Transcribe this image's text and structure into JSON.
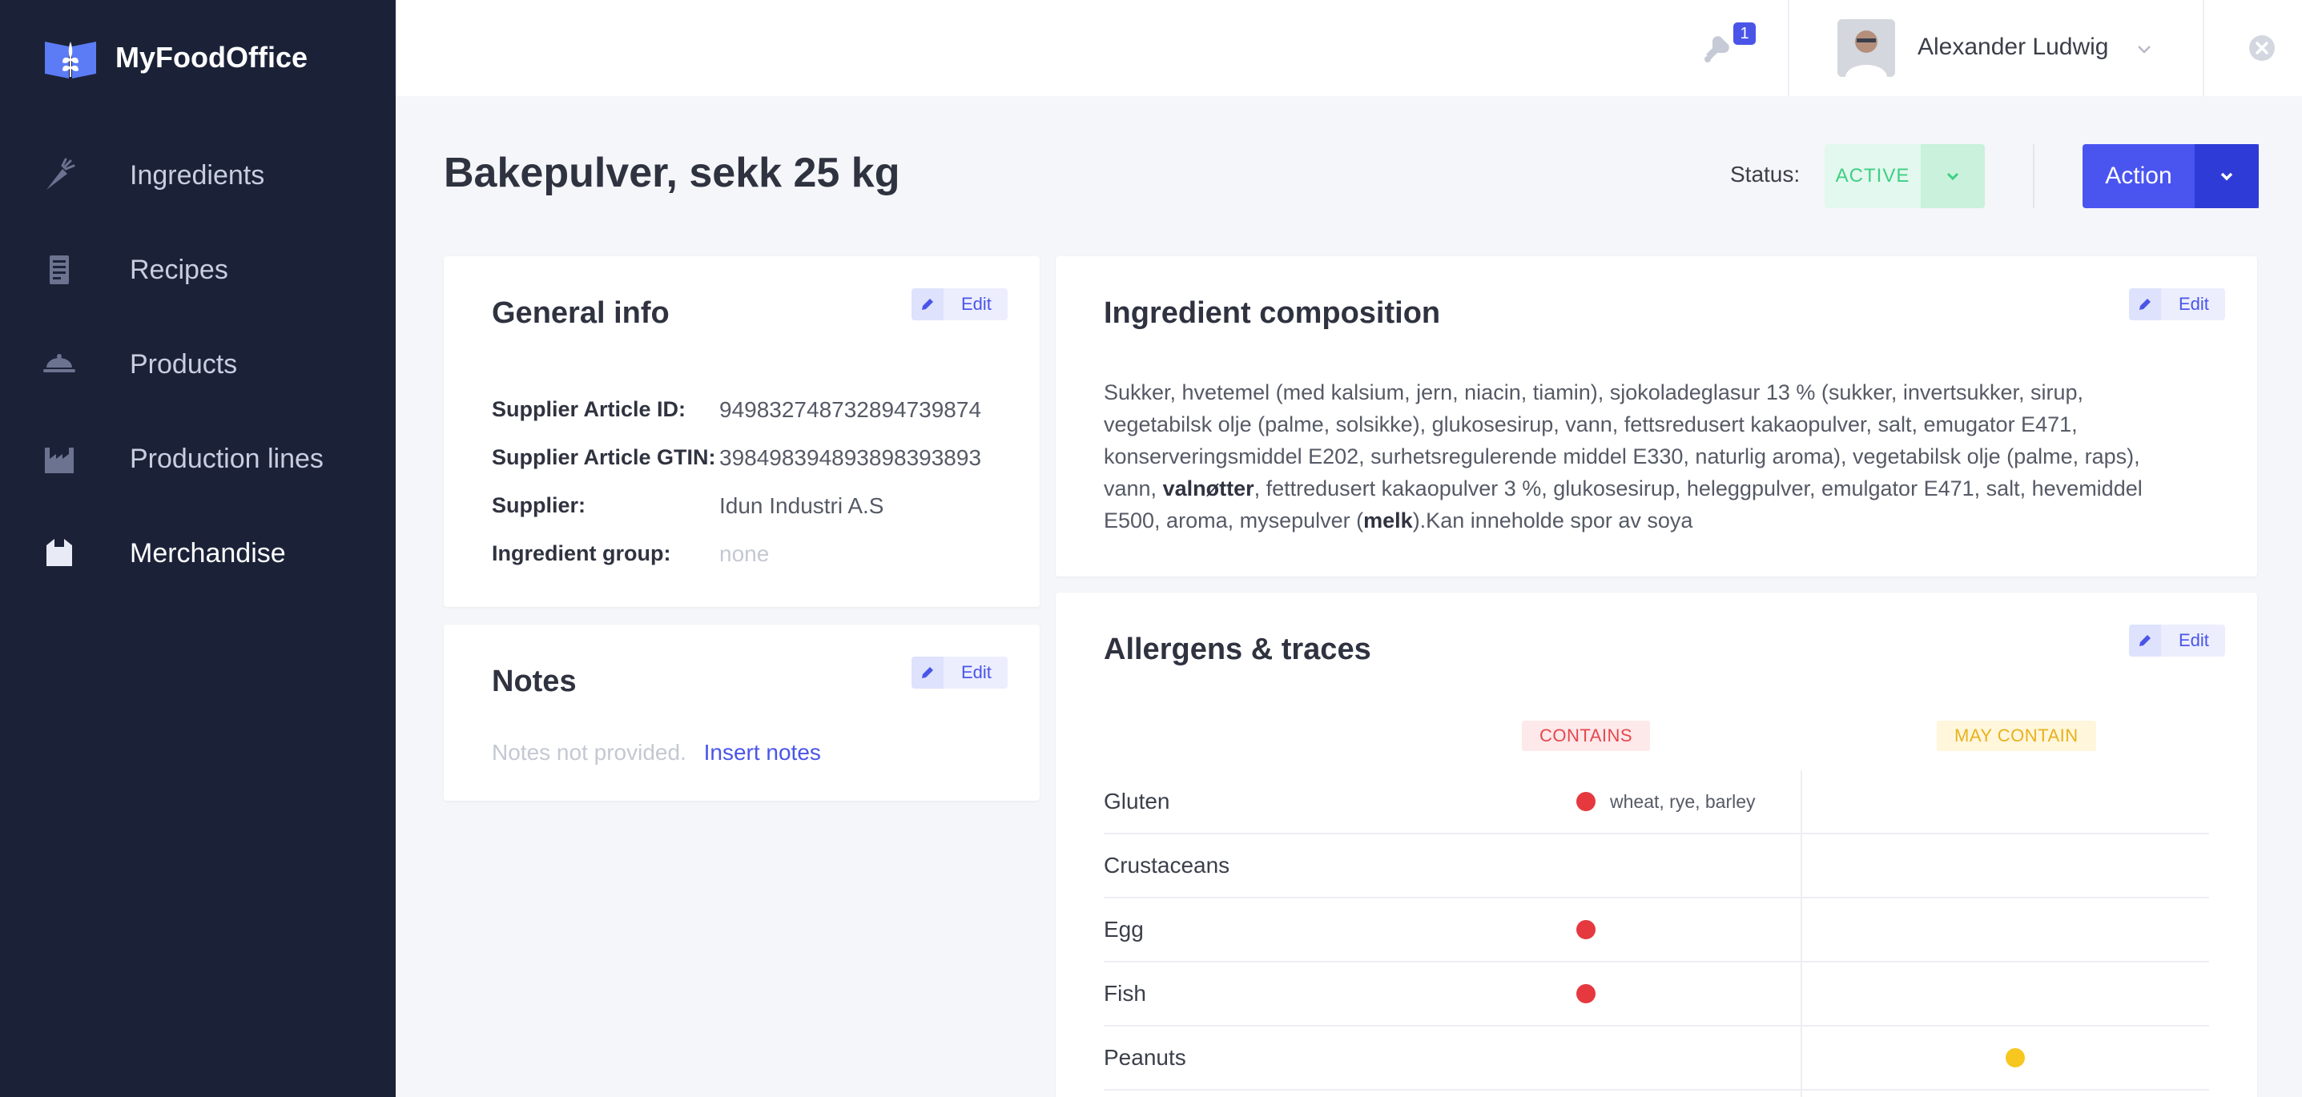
{
  "app": {
    "brand_name": "MyFoodOffice"
  },
  "sidebar": {
    "items": [
      {
        "label": "Ingredients",
        "icon": "carrot-icon"
      },
      {
        "label": "Recipes",
        "icon": "recipe-book-icon"
      },
      {
        "label": "Products",
        "icon": "dish-icon"
      },
      {
        "label": "Production lines",
        "icon": "factory-icon"
      },
      {
        "label": "Merchandise",
        "icon": "box-icon",
        "active": true
      }
    ]
  },
  "topbar": {
    "notification_count": "1",
    "user_name": "Alexander Ludwig"
  },
  "page": {
    "title": "Bakepulver, sekk 25 kg",
    "status_label": "Status:",
    "status_value": "ACTIVE",
    "action_label": "Action"
  },
  "general_info": {
    "title": "General info",
    "edit_label": "Edit",
    "rows": [
      {
        "label": "Supplier Article ID:",
        "value": "949832748732894739874"
      },
      {
        "label": "Supplier Article GTIN:",
        "value": "398498394893898393893"
      },
      {
        "label": "Supplier:",
        "value": "Idun Industri A.S"
      },
      {
        "label": "Ingredient group:",
        "value": "none"
      }
    ]
  },
  "notes": {
    "title": "Notes",
    "edit_label": "Edit",
    "empty_text": "Notes not provided.",
    "insert_link": "Insert notes"
  },
  "composition": {
    "title": "Ingredient composition",
    "edit_label": "Edit",
    "text_part1": "Sukker, hvetemel (med kalsium, jern, niacin, tiamin), sjokoladeglasur 13 % (sukker, invertsukker, sirup, vegetabilsk olje (palme, solsikke), glukosesirup, vann, fettsredusert kakaopulver, salt, emugator E471, konserveringsmiddel E202, surhetsregulerende middel E330, naturlig aroma), vegetabilsk olje (palme, raps), vann, ",
    "bold1": "valnøtter",
    "text_part2": ", fettredusert kakaopulver 3 %, glukosesirup, heleggpulver, emulgator E471, salt, hevemiddel E500, aroma, mysepulver (",
    "bold2": "melk",
    "text_part3": ").Kan inneholde spor av soya"
  },
  "allergens": {
    "title": "Allergens & traces",
    "edit_label": "Edit",
    "contains_header": "CONTAINS",
    "may_contain_header": "MAY CONTAIN",
    "rows": [
      {
        "name": "Gluten",
        "contains": true,
        "contains_note": "wheat, rye, barley",
        "may_contain": false
      },
      {
        "name": "Crustaceans",
        "contains": false,
        "contains_note": "",
        "may_contain": false
      },
      {
        "name": "Egg",
        "contains": true,
        "contains_note": "",
        "may_contain": false
      },
      {
        "name": "Fish",
        "contains": true,
        "contains_note": "",
        "may_contain": false
      },
      {
        "name": "Peanuts",
        "contains": false,
        "contains_note": "",
        "may_contain": true
      }
    ]
  },
  "colors": {
    "sidebar_bg": "#1b2238",
    "accent": "#4a55f0",
    "status_green": "#3fcf85",
    "contains_red": "#e5393f",
    "may_contain_yellow": "#f7c71f"
  }
}
